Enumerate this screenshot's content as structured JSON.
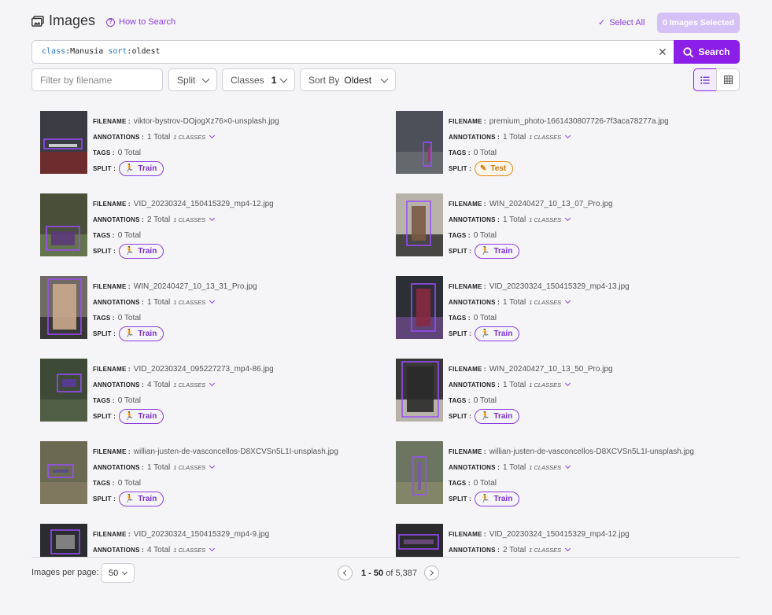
{
  "header": {
    "icon": "images-icon",
    "title": "Images",
    "how_to_search": "How to Search",
    "select_all": "Select All",
    "selected_button": "0 Images Selected"
  },
  "search": {
    "kw_class": "class",
    "val_class": "Manusia",
    "kw_sort": "sort",
    "val_sort": "oldest",
    "clear": "✕",
    "button": "Search"
  },
  "filters": {
    "filename_placeholder": "Filter by filename",
    "split": "Split",
    "classes_label": "Classes",
    "classes_count": "1",
    "sort_label": "Sort By",
    "sort_value": "Oldest"
  },
  "labels": {
    "filename": "FILENAME :",
    "annotations": "ANNOTATIONS :",
    "tags": "TAGS :",
    "split": "SPLIT :"
  },
  "colors": {
    "accent": "#8b1fe8",
    "train": "#8b3fdd",
    "test": "#e38a1c"
  },
  "images": [
    {
      "filename": "viktor-bystrov-DOjogXz76×0-unsplash.jpg",
      "annotations": "1 Total",
      "classes": "1 CLASSES",
      "tags": "0 Total",
      "split": "Train"
    },
    {
      "filename": "premium_photo-1661430807726-7f3aca78277a.jpg",
      "annotations": "1 Total",
      "classes": "1 CLASSES",
      "tags": "0 Total",
      "split": "Test"
    },
    {
      "filename": "VID_20230324_150415329_mp4-12.jpg",
      "annotations": "2 Total",
      "classes": "1 CLASSES",
      "tags": "0 Total",
      "split": "Train"
    },
    {
      "filename": "WIN_20240427_10_13_07_Pro.jpg",
      "annotations": "1 Total",
      "classes": "1 CLASSES",
      "tags": "0 Total",
      "split": "Train"
    },
    {
      "filename": "WIN_20240427_10_13_31_Pro.jpg",
      "annotations": "1 Total",
      "classes": "1 CLASSES",
      "tags": "0 Total",
      "split": "Train"
    },
    {
      "filename": "VID_20230324_150415329_mp4-13.jpg",
      "annotations": "1 Total",
      "classes": "1 CLASSES",
      "tags": "0 Total",
      "split": "Train"
    },
    {
      "filename": "VID_20230324_095227273_mp4-86.jpg",
      "annotations": "4 Total",
      "classes": "1 CLASSES",
      "tags": "0 Total",
      "split": "Train"
    },
    {
      "filename": "WIN_20240427_10_13_50_Pro.jpg",
      "annotations": "1 Total",
      "classes": "1 CLASSES",
      "tags": "0 Total",
      "split": "Train"
    },
    {
      "filename": "willian-justen-de-vasconcellos-D8XCVSn5L1I-unsplash.jpg",
      "annotations": "1 Total",
      "classes": "1 CLASSES",
      "tags": "0 Total",
      "split": "Train"
    },
    {
      "filename": "willian-justen-de-vasconcellos-D8XCVSn5L1I-unsplash.jpg",
      "annotations": "1 Total",
      "classes": "1 CLASSES",
      "tags": "0 Total",
      "split": "Train"
    },
    {
      "filename": "VID_20230324_150415329_mp4-9.jpg",
      "annotations": "4 Total",
      "classes": "1 CLASSES",
      "tags": "0 Total",
      "split": "Train"
    },
    {
      "filename": "VID_20230324_150415329_mp4-12.jpg",
      "annotations": "2 Total",
      "classes": "1 CLASSES",
      "tags": "0 Total",
      "split": "Train"
    }
  ],
  "footer": {
    "per_page_label": "Images per page:",
    "per_page_value": "50",
    "range": "1 - 50",
    "of": "of",
    "total": "5,387"
  }
}
